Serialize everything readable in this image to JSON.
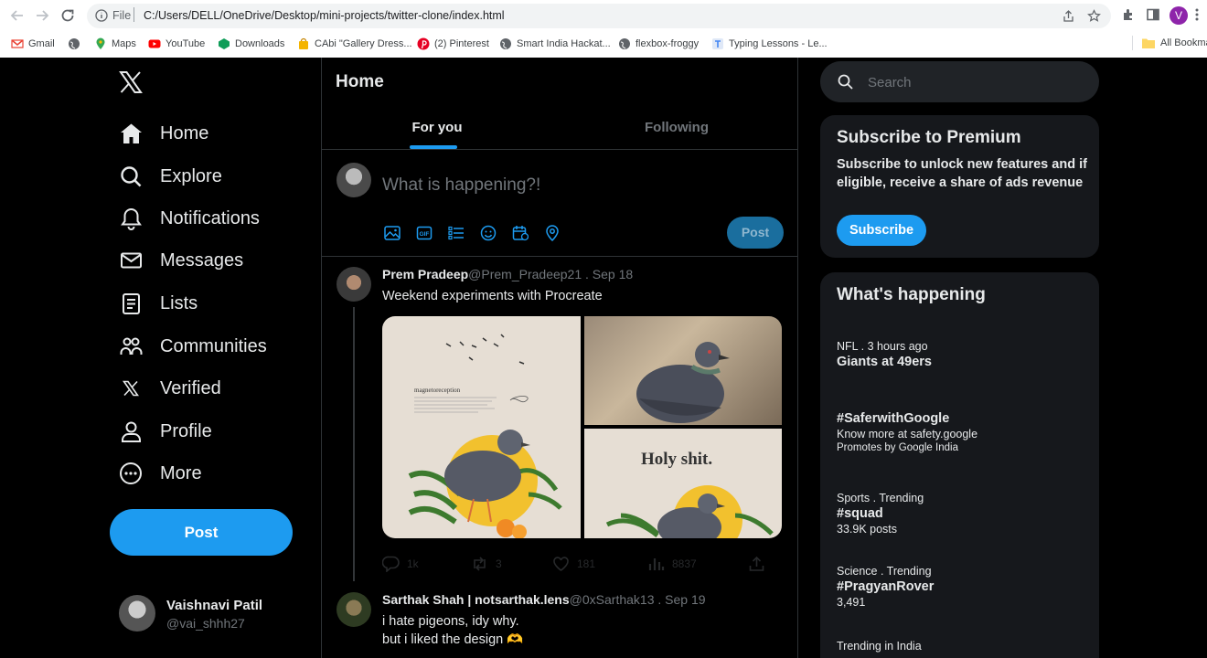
{
  "browser": {
    "scheme_label": "File",
    "url": "C:/Users/DELL/OneDrive/Desktop/mini-projects/twitter-clone/index.html",
    "profile_initial": "V",
    "bookmarks": [
      {
        "label": "Gmail",
        "icon": "gmail-icon",
        "color": "#ea4335"
      },
      {
        "label": "",
        "icon": "globe-icon",
        "color": "#5f6368"
      },
      {
        "label": "Maps",
        "icon": "maps-icon",
        "color": "#34a853"
      },
      {
        "label": "YouTube",
        "icon": "youtube-icon",
        "color": "#ff0000"
      },
      {
        "label": "Downloads",
        "icon": "downloads-icon",
        "color": "#0f9d58"
      },
      {
        "label": "CAbi \"Gallery Dress...",
        "icon": "shopping-bag-icon",
        "color": "#f4b400"
      },
      {
        "label": "(2) Pinterest",
        "icon": "pinterest-icon",
        "color": "#e60023"
      },
      {
        "label": "Smart India Hackat...",
        "icon": "globe-icon",
        "color": "#5f6368"
      },
      {
        "label": "flexbox-froggy",
        "icon": "globe-icon",
        "color": "#5f6368"
      },
      {
        "label": "Typing Lessons - Le...",
        "icon": "typing-icon",
        "color": "#4285f4"
      }
    ],
    "all_bookmarks": "All Bookmarks"
  },
  "nav": {
    "items": [
      {
        "label": "Home",
        "icon": "home-icon"
      },
      {
        "label": "Explore",
        "icon": "search-icon"
      },
      {
        "label": "Notifications",
        "icon": "bell-icon"
      },
      {
        "label": "Messages",
        "icon": "envelope-icon"
      },
      {
        "label": "Lists",
        "icon": "list-icon"
      },
      {
        "label": "Communities",
        "icon": "communities-icon"
      },
      {
        "label": "Verified",
        "icon": "x-logo-icon"
      },
      {
        "label": "Profile",
        "icon": "person-icon"
      },
      {
        "label": "More",
        "icon": "more-circle-icon"
      }
    ],
    "post_label": "Post"
  },
  "account": {
    "name": "Vaishnavi Patil",
    "handle": "@vai_shhh27"
  },
  "main": {
    "title": "Home",
    "tabs": [
      {
        "label": "For you",
        "active": true
      },
      {
        "label": "Following",
        "active": false
      }
    ],
    "composer": {
      "placeholder": "What is happening?!",
      "post_label": "Post"
    },
    "tweets": [
      {
        "name": "Prem Pradeep",
        "handle": "@Prem_Pradeep21 . Sep 18",
        "text": "Weekend experiments with Procreate",
        "media": {
          "poster_heading": "magnetoreception",
          "poster_text": "Holy shit."
        },
        "actions": {
          "replies": "1k",
          "retweets": "3",
          "likes": "181",
          "views": "8837"
        }
      },
      {
        "name": "Sarthak Shah | notsarthak.lens",
        "handle": "@0xSarthak13 . Sep 19",
        "text_line1": "i hate pigeons, idy why.",
        "text_line2": "but i liked the design 🫶"
      }
    ]
  },
  "sidebar": {
    "search_placeholder": "Search",
    "premium": {
      "title": "Subscribe to Premium",
      "description": "Subscribe to unlock new features and if eligible, receive a share of ads revenue",
      "button": "Subscribe"
    },
    "trends": {
      "title": "What's happening",
      "items": [
        {
          "meta": "NFL . 3 hours ago",
          "topic": "Giants at 49ers",
          "sub": "",
          "sub2": ""
        },
        {
          "meta": "",
          "topic": "#SaferwithGoogle",
          "sub": "Know more at safety.google",
          "sub2": "Promotes by Google India"
        },
        {
          "meta": "Sports . Trending",
          "topic": "#squad",
          "sub": "33.9K posts",
          "sub2": ""
        },
        {
          "meta": "Science . Trending",
          "topic": "#PragyanRover",
          "sub": "3,491",
          "sub2": ""
        },
        {
          "meta": "Trending in India",
          "topic": "",
          "sub": "",
          "sub2": ""
        }
      ]
    }
  },
  "colors": {
    "accent": "#1d9bf0",
    "background": "#000000",
    "card": "#16181c"
  }
}
